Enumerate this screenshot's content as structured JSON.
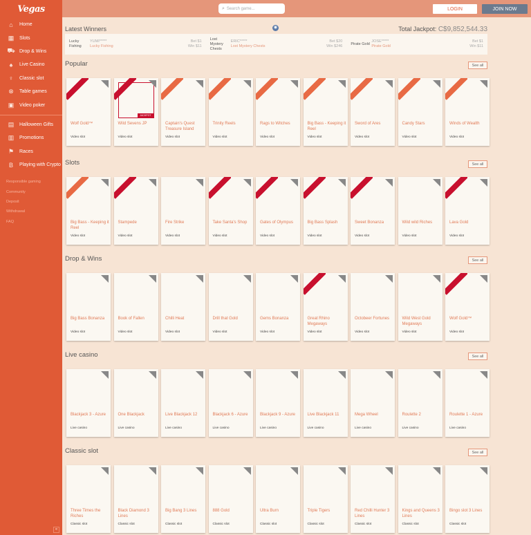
{
  "sidebar": {
    "logo": "Vegas",
    "items": [
      {
        "label": "Home",
        "icon": "home-icon",
        "glyph": "⌂"
      },
      {
        "label": "Slots",
        "icon": "slots-icon",
        "glyph": "▦"
      },
      {
        "label": "Drop & Wins",
        "icon": "drop-wins-icon",
        "glyph": "⛟"
      },
      {
        "label": "Live Casino",
        "icon": "live-casino-icon",
        "glyph": "♠"
      },
      {
        "label": "Classic slot",
        "icon": "classic-slot-icon",
        "glyph": "♀"
      },
      {
        "label": "Table games",
        "icon": "table-games-icon",
        "glyph": "⊗"
      },
      {
        "label": "Video poker",
        "icon": "video-poker-icon",
        "glyph": "▣"
      }
    ],
    "items2": [
      {
        "label": "Halloween Gifts",
        "icon": "gift-icon",
        "glyph": "▤"
      },
      {
        "label": "Promotions",
        "icon": "promotions-icon",
        "glyph": "▥"
      },
      {
        "label": "Races",
        "icon": "races-flag-icon",
        "glyph": "⚑"
      },
      {
        "label": "Playing with Crypto",
        "icon": "bitcoin-icon",
        "glyph": "B"
      }
    ],
    "small_links": [
      "Responsible gaming",
      "Community",
      "Deposit",
      "Withdrawal",
      "FAQ"
    ],
    "collapse": "«"
  },
  "topbar": {
    "search_placeholder": "Search game...",
    "login": "LOGIN",
    "join": "JOIN NOW"
  },
  "winners": {
    "title": "Latest Winners",
    "jackpot_label": "Total Jackpot:",
    "jackpot_value": "C$9,852,544.33",
    "rows": [
      {
        "game": "Lucky Fishing",
        "user": "YUMI*****",
        "sub": "Lucky Fishing",
        "amt1": "Bet $1",
        "amt2": "Win $11"
      },
      {
        "game": "Lost Mystery Chests",
        "user": "ERIC*****",
        "sub": "Lost Mystery Chests",
        "amt1": "Bet $20",
        "amt2": "Win $246"
      },
      {
        "game": "Pirate Gold",
        "user": "JOSE*****",
        "sub": "Pirate Gold",
        "amt1": "Bet $1",
        "amt2": "Win $11"
      }
    ]
  },
  "see_all": "See all",
  "sections": [
    {
      "title": "Popular",
      "cards": [
        {
          "name": "Wolf Gold™",
          "cat": "Video slot",
          "ribbon": "red"
        },
        {
          "name": "Wild Sevens JP",
          "cat": "Video slot",
          "ribbon": "red",
          "jackpot": "JACKPOT"
        },
        {
          "name": "Captain's Quest Treasure Island",
          "cat": "Video slot",
          "ribbon": "orange"
        },
        {
          "name": "Trinity Reels",
          "cat": "Video slot",
          "ribbon": "orange"
        },
        {
          "name": "Rags to Witches",
          "cat": "Video slot",
          "ribbon": "orange"
        },
        {
          "name": "Big Bass - Keeping it Reel",
          "cat": "Video slot",
          "ribbon": "orange"
        },
        {
          "name": "Sword of Ares",
          "cat": "Video slot",
          "ribbon": "orange"
        },
        {
          "name": "Candy Stars",
          "cat": "Video slot",
          "ribbon": "orange"
        },
        {
          "name": "Winds of Wealth",
          "cat": "Video slot",
          "ribbon": "orange"
        }
      ]
    },
    {
      "title": "Slots",
      "cards": [
        {
          "name": "Big Bass - Keeping it Reel",
          "cat": "Video slot",
          "ribbon": "orange"
        },
        {
          "name": "Stampede",
          "cat": "Video slot",
          "ribbon": "red"
        },
        {
          "name": "Fire Strike",
          "cat": "Video slot",
          "ribbon": ""
        },
        {
          "name": "Take Santa's Shop",
          "cat": "Video slot",
          "ribbon": "red"
        },
        {
          "name": "Gates of Olympus",
          "cat": "Video slot",
          "ribbon": "red"
        },
        {
          "name": "Big Bass Splash",
          "cat": "Video slot",
          "ribbon": "red"
        },
        {
          "name": "Sweet Bonanza",
          "cat": "Video slot",
          "ribbon": "red"
        },
        {
          "name": "Wild wild Riches",
          "cat": "Video slot",
          "ribbon": ""
        },
        {
          "name": "Lava Gold",
          "cat": "Video slot",
          "ribbon": "red"
        }
      ]
    },
    {
      "title": "Drop & Wins",
      "cards": [
        {
          "name": "Big Bass Bonanza",
          "cat": "Video slot",
          "ribbon": ""
        },
        {
          "name": "Book of Fallen",
          "cat": "Video slot",
          "ribbon": ""
        },
        {
          "name": "Chilli Heat",
          "cat": "Video slot",
          "ribbon": ""
        },
        {
          "name": "Drill that Gold",
          "cat": "Video slot",
          "ribbon": ""
        },
        {
          "name": "Gems Bonanza",
          "cat": "Video slot",
          "ribbon": ""
        },
        {
          "name": "Great Rhino Megaways",
          "cat": "Video slot",
          "ribbon": "red"
        },
        {
          "name": "Octobeer Fortunes",
          "cat": "Video slot",
          "ribbon": ""
        },
        {
          "name": "Wild West Gold Megaways",
          "cat": "Video slot",
          "ribbon": ""
        },
        {
          "name": "Wolf Gold™",
          "cat": "Video slot",
          "ribbon": "red"
        }
      ]
    },
    {
      "title": "Live casino",
      "cards": [
        {
          "name": "Blackjack 3 - Azure",
          "cat": "Live casino",
          "ribbon": ""
        },
        {
          "name": "One Blackjack",
          "cat": "Live casino",
          "ribbon": ""
        },
        {
          "name": "Live Blackjack 12",
          "cat": "Live casino",
          "ribbon": ""
        },
        {
          "name": "Blackjack 6 - Azure",
          "cat": "Live casino",
          "ribbon": ""
        },
        {
          "name": "Blackjack 9 - Azure",
          "cat": "Live casino",
          "ribbon": ""
        },
        {
          "name": "Live Blackjack 11",
          "cat": "Live casino",
          "ribbon": ""
        },
        {
          "name": "Mega Wheel",
          "cat": "Live casino",
          "ribbon": ""
        },
        {
          "name": "Roulette 2",
          "cat": "Live casino",
          "ribbon": ""
        },
        {
          "name": "Roulette 1 - Azure",
          "cat": "Live casino",
          "ribbon": ""
        }
      ]
    },
    {
      "title": "Classic slot",
      "cards": [
        {
          "name": "Three Times the Riches",
          "cat": "Classic slot",
          "ribbon": ""
        },
        {
          "name": "Black Diamond 3 Lines",
          "cat": "Classic slot",
          "ribbon": ""
        },
        {
          "name": "Big Bang 3 Lines",
          "cat": "Classic slot",
          "ribbon": ""
        },
        {
          "name": "888 Gold",
          "cat": "Classic slot",
          "ribbon": ""
        },
        {
          "name": "Ultra Burn",
          "cat": "Classic slot",
          "ribbon": ""
        },
        {
          "name": "Triple Tigers",
          "cat": "Classic slot",
          "ribbon": ""
        },
        {
          "name": "Red Chilli Hunter 3 Lines",
          "cat": "Classic slot",
          "ribbon": ""
        },
        {
          "name": "Kings and Queens 3 Lines",
          "cat": "Classic slot",
          "ribbon": ""
        },
        {
          "name": "Bingo slot 3 Lines",
          "cat": "Classic slot",
          "ribbon": ""
        }
      ]
    }
  ]
}
